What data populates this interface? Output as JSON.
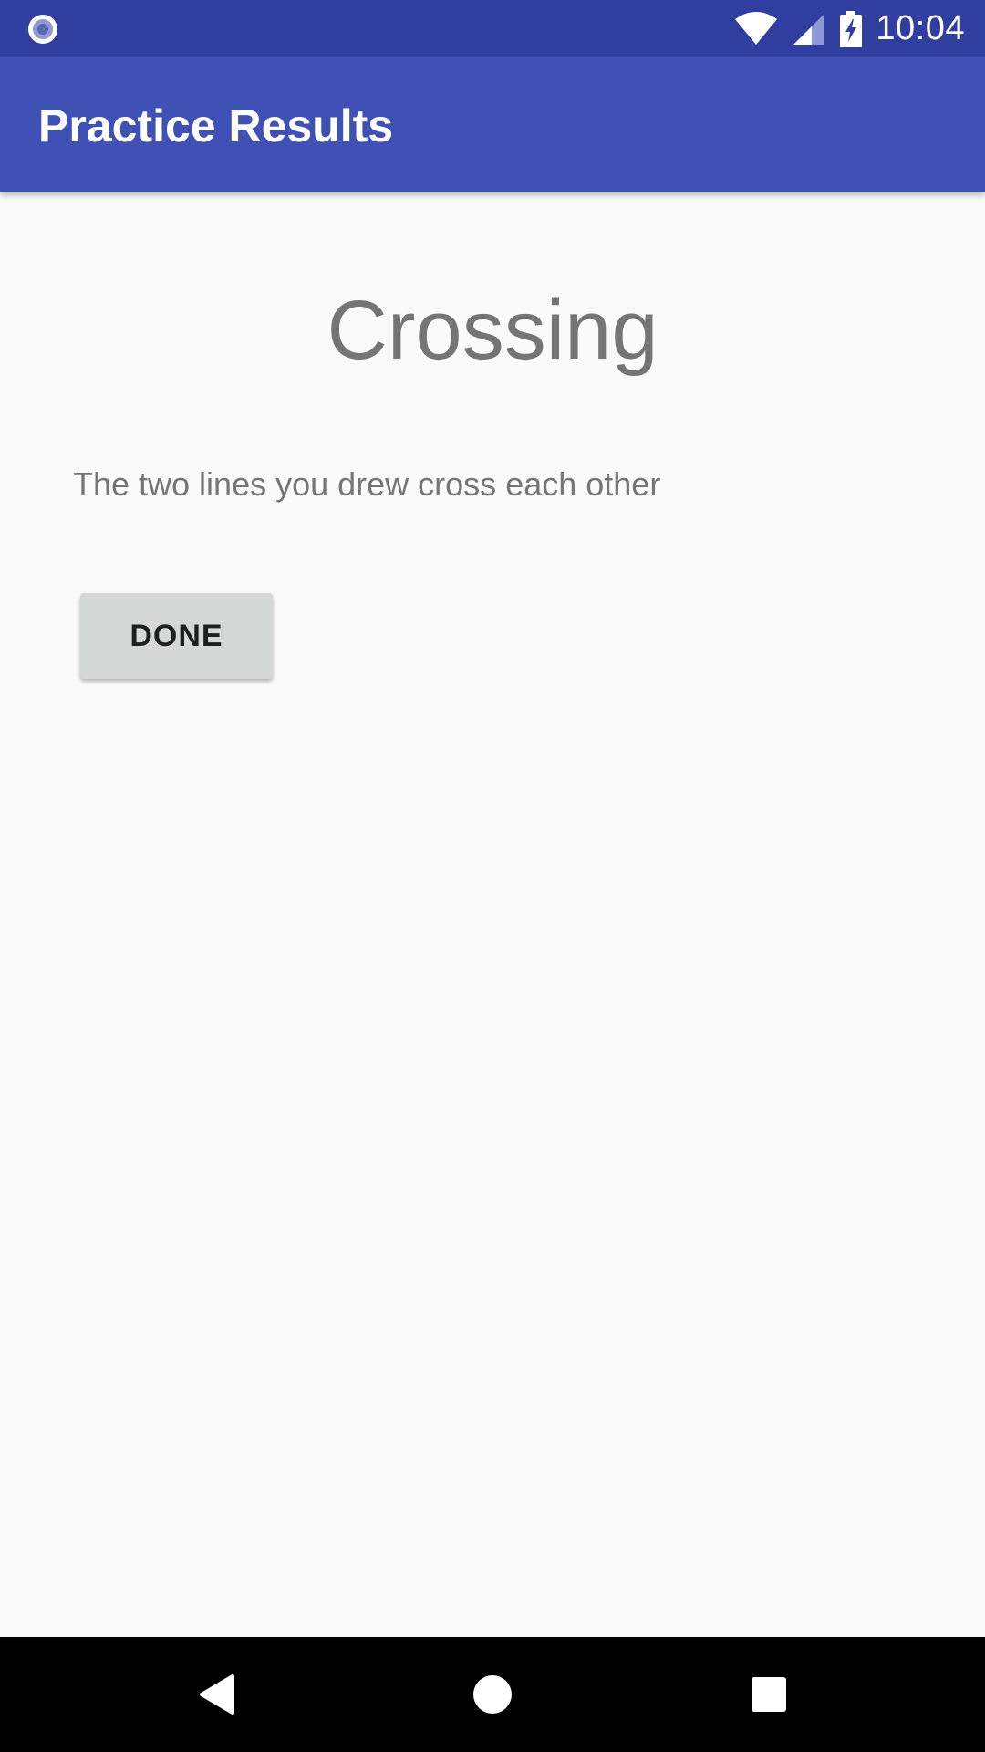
{
  "status_bar": {
    "time": "10:04",
    "left_icon": "record-icon",
    "icons": [
      "wifi-icon",
      "cell-signal-icon",
      "battery-charging-icon"
    ]
  },
  "app_bar": {
    "title": "Practice Results"
  },
  "result": {
    "title": "Crossing",
    "description": "The two lines you drew cross each other",
    "done_label": "DONE"
  },
  "nav_bar": {
    "buttons": [
      "back-icon",
      "home-icon",
      "recents-icon"
    ]
  },
  "colors": {
    "status_bar": "#303f9f",
    "app_bar": "#3f51b5",
    "background": "#fafafa",
    "text_secondary": "#757575",
    "button": "#d6d7d7"
  }
}
